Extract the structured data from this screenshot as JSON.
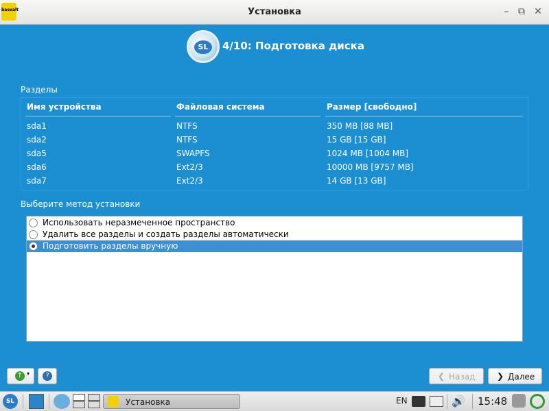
{
  "window": {
    "title": "Установка",
    "app_icon_text": "basealt"
  },
  "header": {
    "step_title": "4/10: Подготовка диска",
    "logo_text": "SL"
  },
  "partitions": {
    "section_label": "Разделы",
    "columns": [
      "Имя устройства",
      "Файловая система",
      "Размер [свободно]"
    ],
    "rows": [
      {
        "device": "sda1",
        "fs": "NTFS",
        "size": "350 MB [88 MB]"
      },
      {
        "device": "sda2",
        "fs": "NTFS",
        "size": "15 GB [15 GB]"
      },
      {
        "device": "sda5",
        "fs": "SWAPFS",
        "size": "1024 MB [1004 MB]"
      },
      {
        "device": "sda6",
        "fs": "Ext2/3",
        "size": "10000 MB [9757 MB]"
      },
      {
        "device": "sda7",
        "fs": "Ext2/3",
        "size": "14 GB [13 GB]"
      }
    ]
  },
  "method": {
    "section_label": "Выберите метод установки",
    "options": [
      {
        "label": "Использовать неразмеченное пространство",
        "checked": false
      },
      {
        "label": "Удалить все разделы и создать разделы автоматически",
        "checked": false
      },
      {
        "label": "Подготовить разделы вручную",
        "checked": true
      }
    ]
  },
  "buttons": {
    "back": "Назад",
    "next": "Далее",
    "help": "?"
  },
  "taskbar": {
    "task_label": "Установка",
    "lang": "EN",
    "clock": "15:48",
    "start": "SL"
  },
  "colors": {
    "background": "#1b8fd2",
    "selection": "#3d8fd4"
  }
}
